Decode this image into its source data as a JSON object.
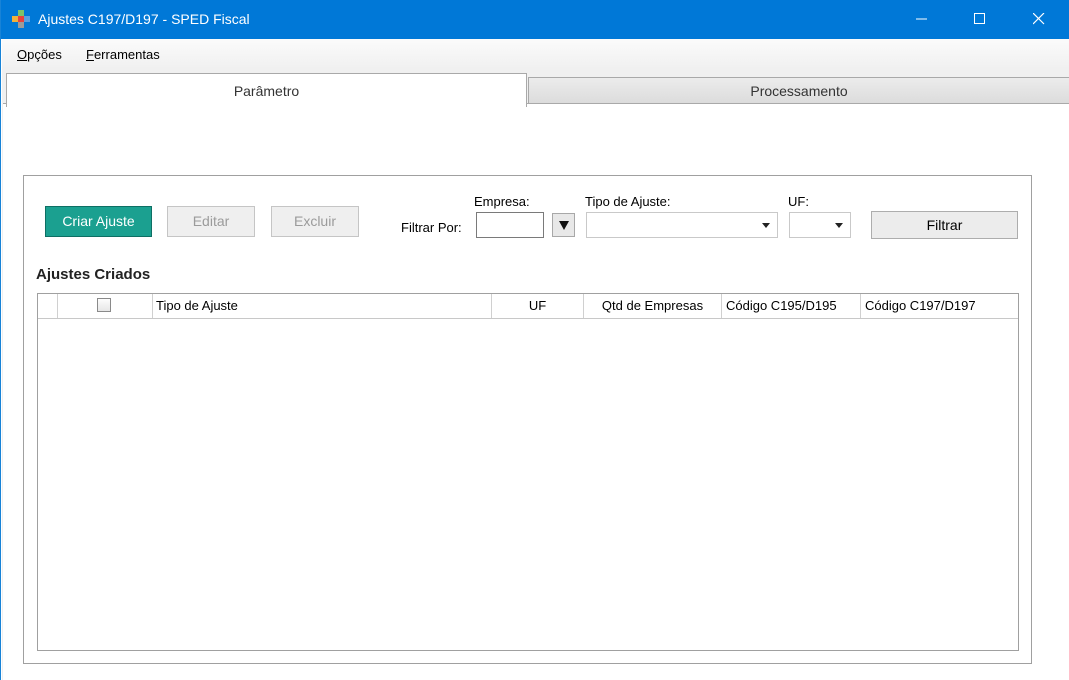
{
  "window": {
    "title": "Ajustes C197/D197 - SPED Fiscal",
    "icon": "app-cross-icon"
  },
  "menu": {
    "opcoes_first": "O",
    "opcoes_rest": "pções",
    "ferramentas_first": "F",
    "ferramentas_rest": "erramentas"
  },
  "tabs": [
    {
      "label": "Parâmetro",
      "active": true
    },
    {
      "label": "Processamento",
      "active": false
    }
  ],
  "toolbar": {
    "criar_label": "Criar Ajuste",
    "editar_label": "Editar",
    "excluir_label": "Excluir",
    "filtrar_label": "Filtrar"
  },
  "filter": {
    "filtrar_por_label": "Filtrar Por:",
    "empresa_label": "Empresa:",
    "empresa_value": "",
    "tipo_label": "Tipo de Ajuste:",
    "tipo_value": "",
    "uf_label": "UF:",
    "uf_value": ""
  },
  "section": {
    "title": "Ajustes Criados"
  },
  "grid": {
    "columns": [
      "",
      "",
      "Tipo de Ajuste",
      "UF",
      "Qtd de Empresas",
      "Código C195/D195",
      "Código C197/D197"
    ],
    "rows": []
  },
  "colors": {
    "titlebar": "#0078d7",
    "primary_button": "#1ba090"
  }
}
